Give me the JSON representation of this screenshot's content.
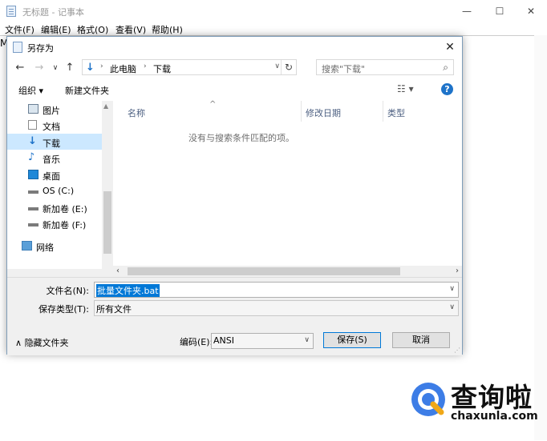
{
  "notepad": {
    "title": "无标题 - 记事本",
    "menu": [
      "文件(F)",
      "编辑(E)",
      "格式(O)",
      "查看(V)",
      "帮助(H)"
    ],
    "content_char": "M"
  },
  "dialog": {
    "title": "另存为",
    "address": {
      "segments": [
        "此电脑",
        "下载"
      ]
    },
    "search_placeholder": "搜索\"下载\"",
    "toolbar": {
      "organize": "组织 ▾",
      "new_folder": "新建文件夹"
    },
    "nav_items": [
      {
        "label": "图片",
        "icon": "pictures-icon"
      },
      {
        "label": "文档",
        "icon": "documents-icon"
      },
      {
        "label": "下载",
        "icon": "downloads-icon",
        "selected": true
      },
      {
        "label": "音乐",
        "icon": "music-icon"
      },
      {
        "label": "桌面",
        "icon": "desktop-icon"
      },
      {
        "label": "OS (C:)",
        "icon": "drive-c-icon"
      },
      {
        "label": "新加卷 (E:)",
        "icon": "drive-icon"
      },
      {
        "label": "新加卷 (F:)",
        "icon": "drive-icon"
      },
      {
        "label": "网络",
        "icon": "network-icon"
      }
    ],
    "columns": [
      "名称",
      "修改日期",
      "类型"
    ],
    "empty_message": "没有与搜索条件匹配的项。",
    "filename_label": "文件名(N):",
    "filename_value": "批量文件夹.bat",
    "filetype_label": "保存类型(T):",
    "filetype_value": "所有文件",
    "hide_folders": "隐藏文件夹",
    "encoding_label": "编码(E):",
    "encoding_value": "ANSI",
    "save_button": "保存(S)",
    "cancel_button": "取消"
  },
  "watermark": {
    "brand": "查询啦",
    "url": "chaxunla.com"
  }
}
